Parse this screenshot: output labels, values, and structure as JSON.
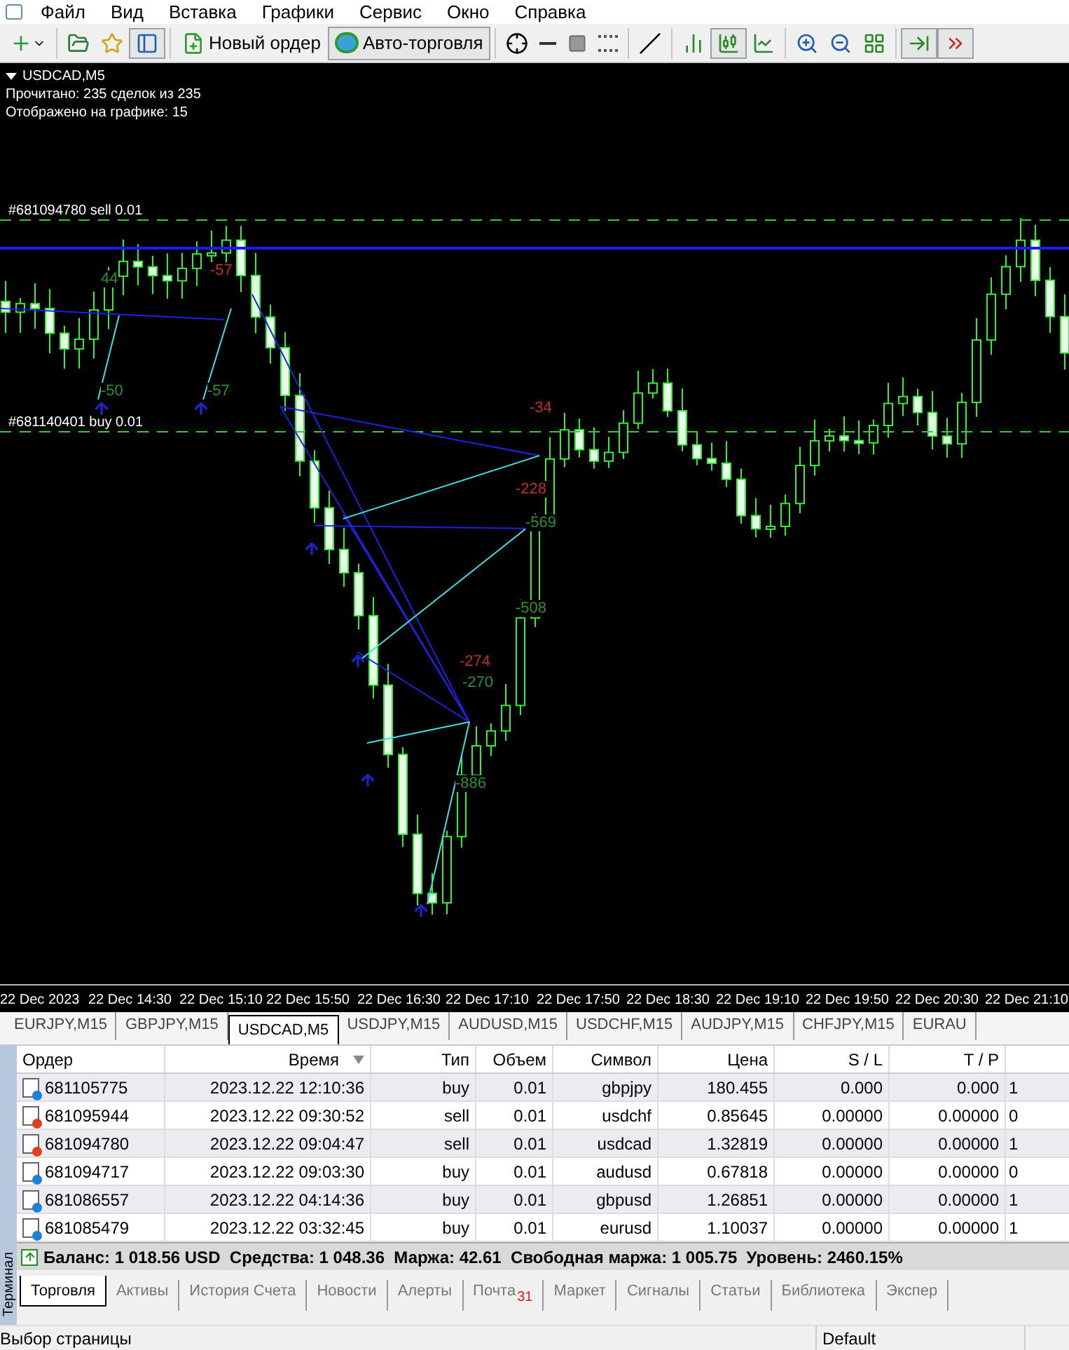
{
  "menu": [
    "Файл",
    "Вид",
    "Вставка",
    "Графики",
    "Сервис",
    "Окно",
    "Справка"
  ],
  "toolbar": {
    "buttons": [
      {
        "label": "Новый ордер",
        "selected": false
      },
      {
        "label": "Авто-торговля",
        "selected": true
      }
    ]
  },
  "chart": {
    "title": "USDCAD,M5",
    "info": [
      "Прочитано: 235 сделок из 235",
      "Отображено на графике: 15"
    ],
    "order_lines": [
      {
        "label": "#681094780 sell 0.01",
        "kind": "sell"
      },
      {
        "label": "#681140401 buy 0.01",
        "kind": "buy"
      }
    ],
    "profit_labels": [
      {
        "text": "44",
        "color": "#2f8f2f"
      },
      {
        "text": "-57",
        "color": "#c03020"
      },
      {
        "text": "-50",
        "color": "#2f8f2f"
      },
      {
        "text": "-57",
        "color": "#2f8f2f"
      },
      {
        "text": "-34",
        "color": "#c03020"
      },
      {
        "text": "-228",
        "color": "#c03020"
      },
      {
        "text": "-569",
        "color": "#2f8f2f"
      },
      {
        "text": "-508",
        "color": "#2f8f2f"
      },
      {
        "text": "-274",
        "color": "#c03020"
      },
      {
        "text": "-270",
        "color": "#2f8f2f"
      },
      {
        "text": "-886",
        "color": "#2f8f2f"
      }
    ],
    "time_axis": [
      "22 Dec 2023",
      "22 Dec 14:30",
      "22 Dec 15:10",
      "22 Dec 15:50",
      "22 Dec 16:30",
      "22 Dec 17:10",
      "22 Dec 17:50",
      "22 Dec 18:30",
      "22 Dec 19:10",
      "22 Dec 19:50",
      "22 Dec 20:30",
      "22 Dec 21:10"
    ]
  },
  "chart_tabs": [
    {
      "label": "EURJPY,M15",
      "selected": false
    },
    {
      "label": "GBPJPY,M15",
      "selected": false
    },
    {
      "label": "USDCAD,M5",
      "selected": true
    },
    {
      "label": "USDJPY,M15",
      "selected": false
    },
    {
      "label": "AUDUSD,M15",
      "selected": false
    },
    {
      "label": "USDCHF,M15",
      "selected": false
    },
    {
      "label": "AUDJPY,M15",
      "selected": false
    },
    {
      "label": "CHFJPY,M15",
      "selected": false
    },
    {
      "label": "EURAU",
      "selected": false
    }
  ],
  "terminal": {
    "side_label": "Терминал",
    "table": {
      "columns": [
        "Ордер",
        "Время",
        "Тип",
        "Объем",
        "Символ",
        "Цена",
        "S / L",
        "T / P"
      ],
      "rows": [
        {
          "order": "681105775",
          "time": "2023.12.22 12:10:36",
          "type": "buy",
          "volume": "0.01",
          "symbol": "gbpjpy",
          "price": "180.455",
          "sl": "0.000",
          "tp": "0.000",
          "column_9": "1",
          "color": "#1e7fd8"
        },
        {
          "order": "681095944",
          "time": "2023.12.22 09:30:52",
          "type": "sell",
          "volume": "0.01",
          "symbol": "usdchf",
          "price": "0.85645",
          "sl": "0.00000",
          "tp": "0.00000",
          "column_9": "0",
          "color": "#e0401c"
        },
        {
          "order": "681094780",
          "time": "2023.12.22 09:04:47",
          "type": "sell",
          "volume": "0.01",
          "symbol": "usdcad",
          "price": "1.32819",
          "sl": "0.00000",
          "tp": "0.00000",
          "column_9": "1",
          "color": "#e0401c"
        },
        {
          "order": "681094717",
          "time": "2023.12.22 09:03:30",
          "type": "buy",
          "volume": "0.01",
          "symbol": "audusd",
          "price": "0.67818",
          "sl": "0.00000",
          "tp": "0.00000",
          "column_9": "0",
          "color": "#1e7fd8"
        },
        {
          "order": "681086557",
          "time": "2023.12.22 04:14:36",
          "type": "buy",
          "volume": "0.01",
          "symbol": "gbpusd",
          "price": "1.26851",
          "sl": "0.00000",
          "tp": "0.00000",
          "column_9": "1",
          "color": "#1e7fd8"
        },
        {
          "order": "681085479",
          "time": "2023.12.22 03:32:45",
          "type": "buy",
          "volume": "0.01",
          "symbol": "eurusd",
          "price": "1.10037",
          "sl": "0.00000",
          "tp": "0.00000",
          "column_9": "1",
          "color": "#1e7fd8"
        }
      ]
    },
    "summary": "Баланс: 1 018.56 USD  Средства: 1 048.36  Маржа: 42.61  Свободная маржа: 1 005.75  Уровень: 2460.15%",
    "tabs": [
      {
        "label": "Торговля",
        "selected": true
      },
      {
        "label": "Активы",
        "selected": false
      },
      {
        "label": "История Счета",
        "selected": false
      },
      {
        "label": "Новости",
        "selected": false
      },
      {
        "label": "Алерты",
        "selected": false
      },
      {
        "label": "Почта",
        "selected": false,
        "badge": "31"
      },
      {
        "label": "Маркет",
        "selected": false
      },
      {
        "label": "Сигналы",
        "selected": false
      },
      {
        "label": "Статьи",
        "selected": false
      },
      {
        "label": "Библиотека",
        "selected": false
      },
      {
        "label": "Экспер",
        "selected": false
      }
    ]
  },
  "status_bar": {
    "left": "Выбор страницы",
    "profile": "Default"
  }
}
